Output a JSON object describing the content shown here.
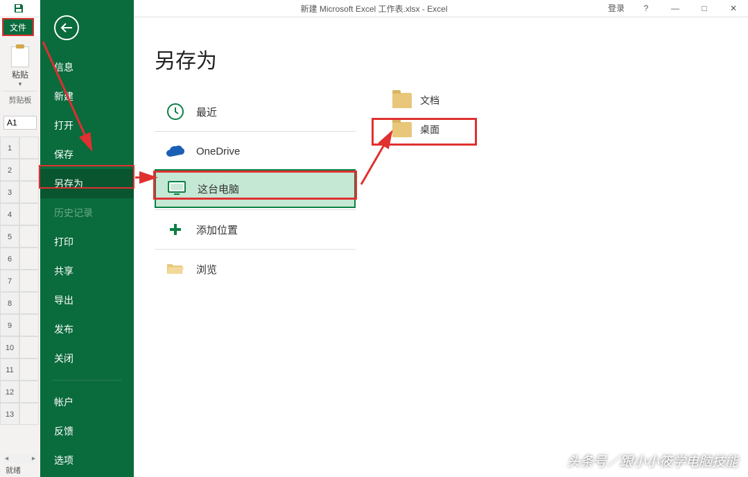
{
  "titlebar": {
    "title": "新建 Microsoft Excel 工作表.xlsx - Excel",
    "login": "登录",
    "help": "?",
    "min": "—",
    "max": "□",
    "close": "✕"
  },
  "ribbon": {
    "file_label": "文件",
    "paste_label": "粘贴",
    "clipboard_label": "剪贴板"
  },
  "cell_ref": "A1",
  "grid_rows": [
    "1",
    "2",
    "3",
    "4",
    "5",
    "6",
    "7",
    "8",
    "9",
    "10",
    "11",
    "12",
    "13"
  ],
  "status_bar": "就绪",
  "nav": {
    "info": "信息",
    "new": "新建",
    "open": "打开",
    "save": "保存",
    "saveas": "另存为",
    "history": "历史记录",
    "print": "打印",
    "share": "共享",
    "export": "导出",
    "publish": "发布",
    "close": "关闭",
    "account": "帐户",
    "feedback": "反馈",
    "options": "选项"
  },
  "page": {
    "title": "另存为",
    "recent": "最近",
    "onedrive": "OneDrive",
    "thispc": "这台电脑",
    "addplace": "添加位置",
    "browse": "浏览"
  },
  "folders": {
    "documents": "文档",
    "desktop": "桌面"
  },
  "watermark": "头条号／跟小小筱学电脑技能"
}
